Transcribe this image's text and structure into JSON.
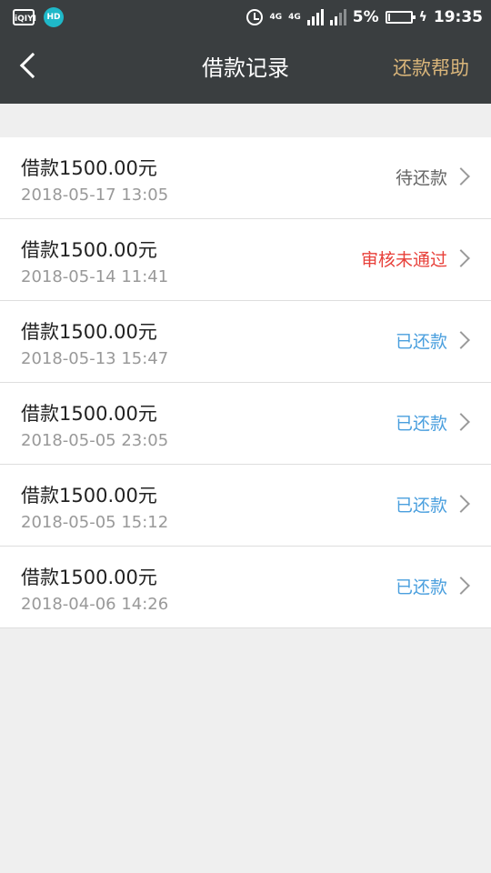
{
  "status_bar": {
    "apps": [
      "iQIYI",
      "HD"
    ],
    "net_tag_1": "4G",
    "net_tag_2": "4G",
    "battery": "5%",
    "time": "19:35",
    "icons": [
      "iqiyi-icon",
      "hd-icon",
      "alarm-icon",
      "signal-icon",
      "battery-icon",
      "charging-icon"
    ]
  },
  "nav": {
    "title": "借款记录",
    "help": "还款帮助",
    "back_icon": "chevron-left-icon"
  },
  "colors": {
    "header_bg": "#3a3e40",
    "help_gold": "#d9b57a",
    "pending_gray": "#666666",
    "rejected_red": "#e8403a",
    "repaid_blue": "#4a9fde"
  },
  "records": [
    {
      "title": "借款1500.00元",
      "time": "2018-05-17 13:05",
      "status": "待还款",
      "status_color": "#666666"
    },
    {
      "title": "借款1500.00元",
      "time": "2018-05-14 11:41",
      "status": "审核未通过",
      "status_color": "#e8403a"
    },
    {
      "title": "借款1500.00元",
      "time": "2018-05-13 15:47",
      "status": "已还款",
      "status_color": "#4a9fde"
    },
    {
      "title": "借款1500.00元",
      "time": "2018-05-05 23:05",
      "status": "已还款",
      "status_color": "#4a9fde"
    },
    {
      "title": "借款1500.00元",
      "time": "2018-05-05 15:12",
      "status": "已还款",
      "status_color": "#4a9fde"
    },
    {
      "title": "借款1500.00元",
      "time": "2018-04-06 14:26",
      "status": "已还款",
      "status_color": "#4a9fde"
    }
  ]
}
